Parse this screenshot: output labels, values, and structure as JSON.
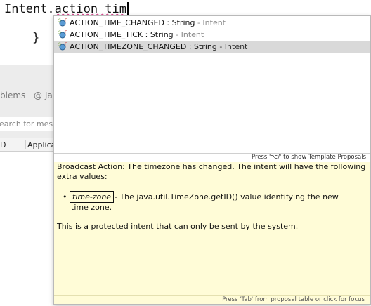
{
  "editor": {
    "code_prefix": "Intent.",
    "code_typed": "action_tim",
    "closing_brace": "}"
  },
  "lower_panel": {
    "tab_problems": "blems",
    "tab_javadoc": "@ Jav",
    "filter_placeholder": "earch for mess",
    "columns": [
      "D",
      "Applica"
    ]
  },
  "completion": {
    "proposals": [
      {
        "name": "ACTION_TIME_CHANGED",
        "type": ": String",
        "owner": "- Intent",
        "selected": false,
        "icon": "static-final-field-icon"
      },
      {
        "name": "ACTION_TIME_TICK",
        "type": ": String",
        "owner": "- Intent",
        "selected": false,
        "icon": "static-final-field-icon"
      },
      {
        "name": "ACTION_TIMEZONE_CHANGED",
        "type": ": String",
        "owner": "- Intent",
        "selected": true,
        "icon": "static-final-field-icon"
      }
    ],
    "list_footer": "Press '⌥/' to show Template Proposals",
    "doc": {
      "summary": "Broadcast Action: The timezone has changed. The intent will have the following extra values:",
      "bullet_param": "time-zone",
      "bullet_text": "- The java.util.TimeZone.getID() value identifying the new time zone.",
      "note": "This is a protected intent that can only be sent by the system."
    },
    "doc_footer": "Press 'Tab' from proposal table or click for focus"
  },
  "colors": {
    "doc_background": "#fffcd7",
    "selected_row": "#d9d9d9",
    "owner_text": "#8a8a8a",
    "squiggle": "#d63384"
  }
}
